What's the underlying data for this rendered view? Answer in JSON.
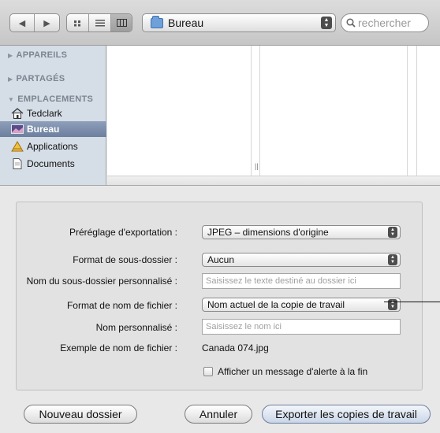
{
  "toolbar": {
    "back_icon": "chevron-left-icon",
    "forward_icon": "chevron-right-icon",
    "view_icons": [
      "icon-view-icon",
      "list-view-icon",
      "column-view-icon"
    ],
    "path_label": "Bureau",
    "search_placeholder": "rechercher"
  },
  "sidebar": {
    "sections": [
      {
        "label": "APPAREILS",
        "expanded": false
      },
      {
        "label": "PARTAGÉS",
        "expanded": false
      },
      {
        "label": "EMPLACEMENTS",
        "expanded": true
      }
    ],
    "items": [
      {
        "label": "Tedclark",
        "icon": "home-icon",
        "selected": false
      },
      {
        "label": "Bureau",
        "icon": "desktop-icon",
        "selected": true
      },
      {
        "label": "Applications",
        "icon": "applications-icon",
        "selected": false
      },
      {
        "label": "Documents",
        "icon": "document-icon",
        "selected": false
      }
    ],
    "selection_color": "#7a8cab"
  },
  "options": {
    "preset_label": "Préréglage d'exportation :",
    "preset_value": "JPEG – dimensions d'origine",
    "subfolder_format_label": "Format de sous-dossier :",
    "subfolder_format_value": "Aucun",
    "subfolder_name_label": "Nom du sous-dossier personnalisé :",
    "subfolder_name_placeholder": "Saisissez le texte destiné au dossier ici",
    "filename_format_label": "Format de nom de fichier :",
    "filename_format_value": "Nom actuel de la copie de travail",
    "custom_name_label": "Nom personnalisé :",
    "custom_name_placeholder": "Saisissez le nom ici",
    "example_label": "Exemple de nom de fichier :",
    "example_value": "Canada 074.jpg",
    "alert_checkbox_label": "Afficher un message d'alerte à la fin",
    "alert_checked": false
  },
  "buttons": {
    "new_folder": "Nouveau dossier",
    "cancel": "Annuler",
    "export": "Exporter les copies de travail"
  }
}
